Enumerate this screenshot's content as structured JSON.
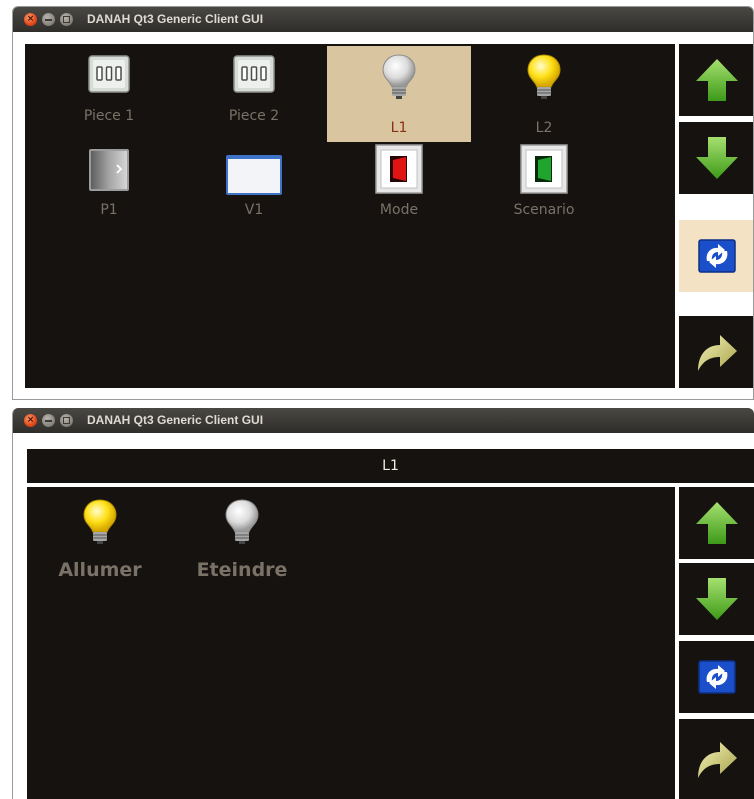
{
  "window_title": "DANAH Qt3 Generic Client GUI",
  "screen1": {
    "items": [
      {
        "label": "Piece 1",
        "icon": "wall-switch-icon",
        "selected": false
      },
      {
        "label": "Piece 2",
        "icon": "wall-switch-icon",
        "selected": false
      },
      {
        "label": "L1",
        "icon": "bulb-off-icon",
        "selected": true
      },
      {
        "label": "L2",
        "icon": "bulb-on-icon",
        "selected": false
      },
      {
        "label": "P1",
        "icon": "door-icon",
        "selected": false
      },
      {
        "label": "V1",
        "icon": "window-icon",
        "selected": false
      },
      {
        "label": "Mode",
        "icon": "red-switch-icon",
        "selected": false
      },
      {
        "label": "Scenario",
        "icon": "green-switch-icon",
        "selected": false
      }
    ]
  },
  "screen2": {
    "header": "L1",
    "actions": [
      {
        "label": "Allumer",
        "icon": "bulb-on-icon"
      },
      {
        "label": "Eteindre",
        "icon": "bulb-off-icon"
      }
    ]
  },
  "sidebar_icons": [
    "arrow-up-icon",
    "arrow-down-icon",
    "refresh-icon",
    "forward-icon"
  ],
  "colors": {
    "panel_bg": "#151210",
    "selected_bg": "#d9c6a1",
    "active_button_bg": "#f3e2c3",
    "label_color": "#7a7266",
    "arrow_green": "#5fb82e",
    "refresh_blue": "#1b4fc9"
  }
}
